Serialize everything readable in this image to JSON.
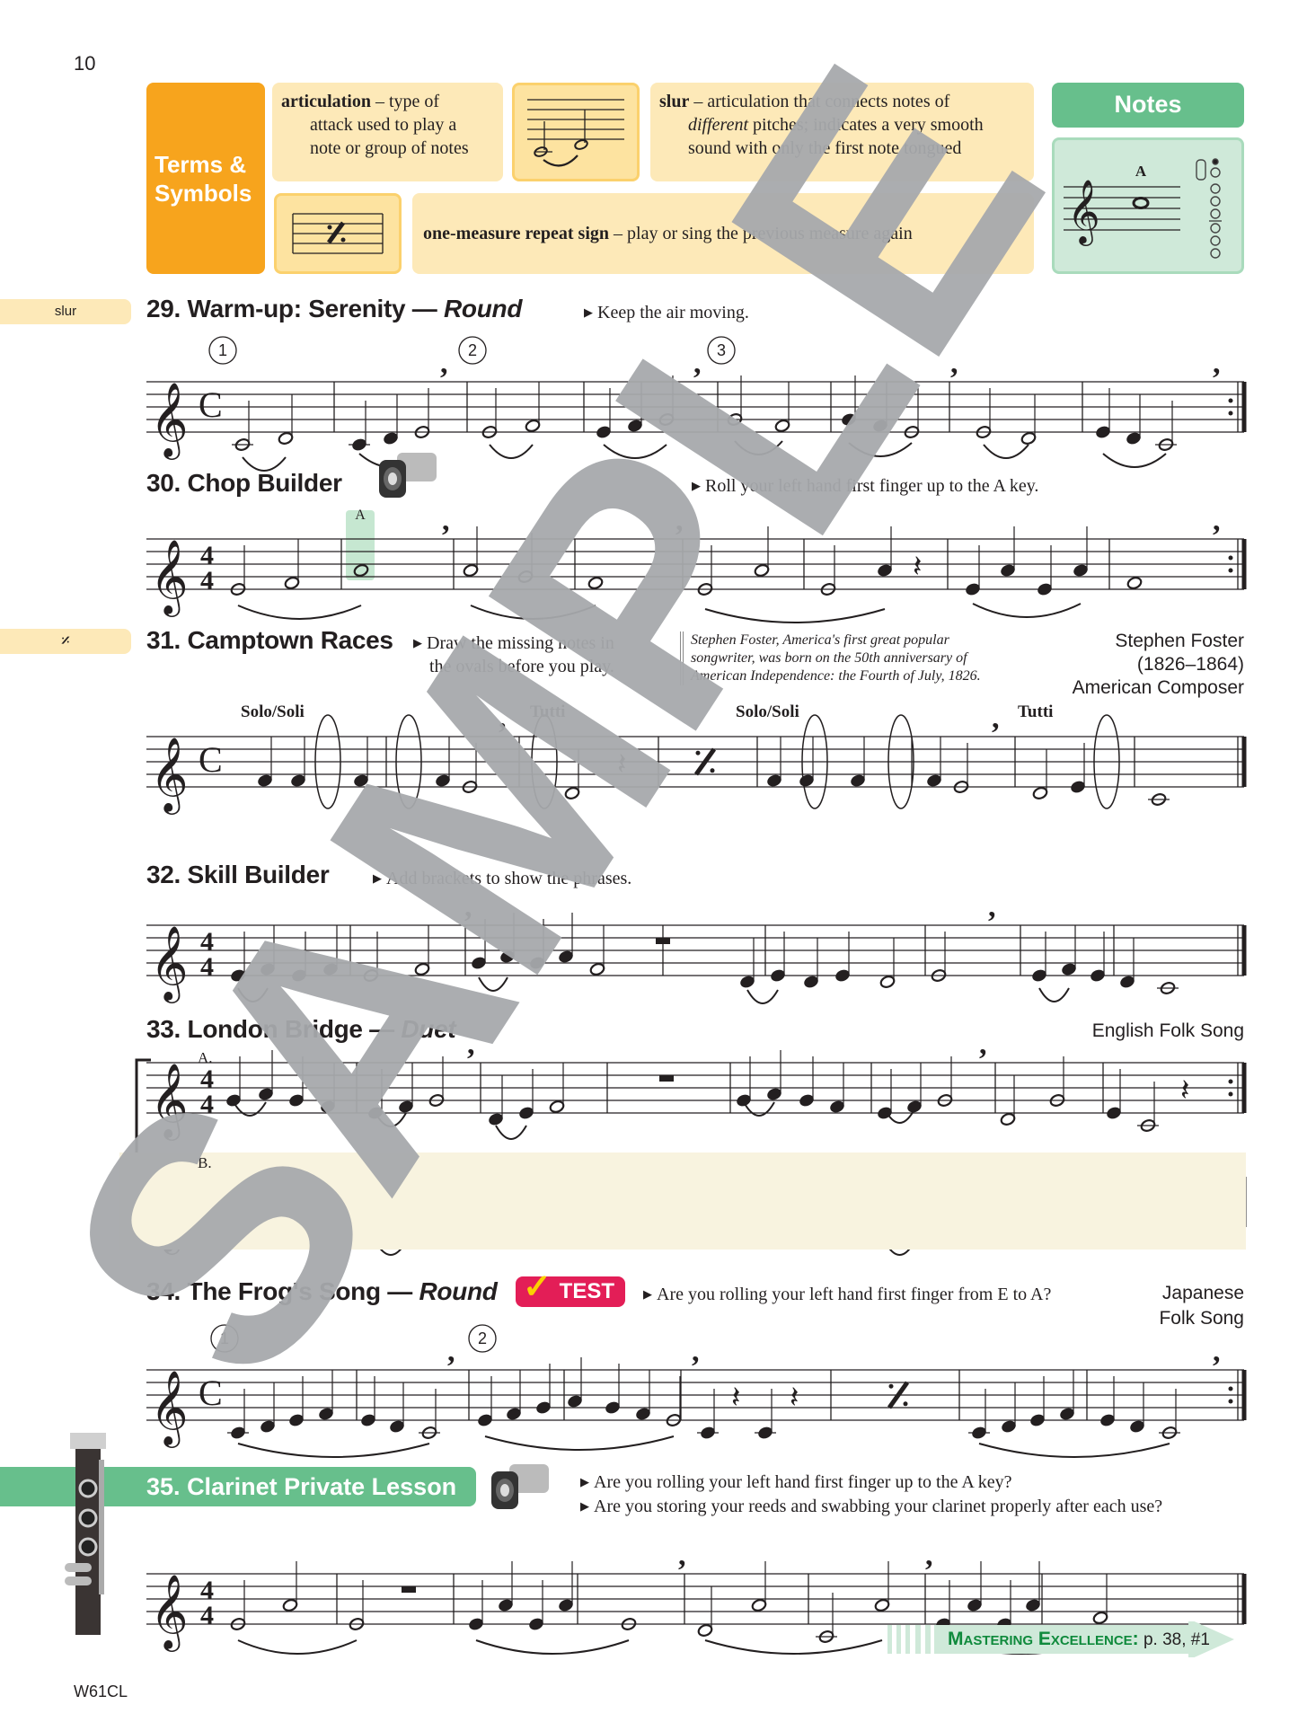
{
  "page": {
    "number": "10",
    "code": "W61CL"
  },
  "terms_symbols": {
    "heading_line1": "Terms &",
    "heading_line2": "Symbols",
    "articulation": {
      "term": "articulation",
      "def_line1": " – type of",
      "def_line2": "attack used to play a",
      "def_line3": "note or group of notes"
    },
    "slur": {
      "term": "slur",
      "def_line1": " – articulation that connects notes of",
      "def_italic": "different",
      "def_line2": " pitches; indicates a very smooth",
      "def_line3": "sound with only the first note tongued"
    },
    "repeat_sign": {
      "term": "one-measure repeat sign",
      "def": " – play or sing the previous measure again",
      "glyph": "𝄎"
    }
  },
  "notes_box": {
    "heading": "Notes",
    "note_name": "A",
    "icon": "fingering-chart-icon"
  },
  "side_tabs": [
    {
      "label": "slur"
    },
    {
      "label": "𝄎"
    }
  ],
  "exercises": [
    {
      "num": "29.",
      "title": "Warm-up: Serenity",
      "dash": " — ",
      "subtitle": "Round",
      "instructions": [
        "Keep the air moving."
      ],
      "time_sig": "C",
      "round_markers": [
        "1",
        "2",
        "3"
      ]
    },
    {
      "num": "30.",
      "title": "Chop Builder",
      "instructions": [
        "Roll your left hand first finger up to the A key."
      ],
      "time_sig": "4/4",
      "highlight_note": "A",
      "icon": "video-camera-icon"
    },
    {
      "num": "31.",
      "title": "Camptown Races",
      "instructions": [
        "Draw the missing notes in",
        "the ovals before you play."
      ],
      "time_sig": "C",
      "trivia": [
        "Stephen Foster, America's first great popular",
        "songwriter, was born on the 50th anniversary of",
        "American Independence: the Fourth of July, 1826."
      ],
      "credit": [
        "Stephen Foster",
        "(1826–1864)",
        "American Composer"
      ],
      "section_labels": [
        "Solo/Soli",
        "Tutti",
        "Solo/Soli",
        "Tutti"
      ]
    },
    {
      "num": "32.",
      "title": "Skill Builder",
      "instructions": [
        "Add brackets to show the phrases."
      ],
      "time_sig": "4/4"
    },
    {
      "num": "33.",
      "title": "London Bridge",
      "dash": " — ",
      "subtitle": "Duet",
      "credit": [
        "English Folk Song"
      ],
      "parts": [
        "A.",
        "B."
      ],
      "time_sig": "4/4"
    },
    {
      "num": "34.",
      "title": "The Frog's Song",
      "dash": " — ",
      "subtitle": "Round",
      "badge": "TEST",
      "instructions": [
        "Are you rolling your left hand first finger from E to A?"
      ],
      "credit": [
        "Japanese",
        "Folk Song"
      ],
      "round_markers": [
        "1",
        "2"
      ],
      "time_sig": "C"
    },
    {
      "num": "35.",
      "title": "Clarinet Private Lesson",
      "instructions": [
        "Are you rolling your left hand first finger up to the A key?",
        "Are you storing your reeds and swabbing your clarinet properly after each use?"
      ],
      "time_sig": "4/4",
      "icon": "video-camera-icon"
    }
  ],
  "mastering": {
    "label": "Mastering Excellence:",
    "ref": " p. 38, #1"
  },
  "watermark": "SAMPLE",
  "colors": {
    "orange": "#f7a41d",
    "cream": "#fde9b8",
    "green": "#67bf8c",
    "light_green": "#cfe9d9",
    "test_red": "#e31e57",
    "watermark_gray": "#a7a9ac"
  }
}
